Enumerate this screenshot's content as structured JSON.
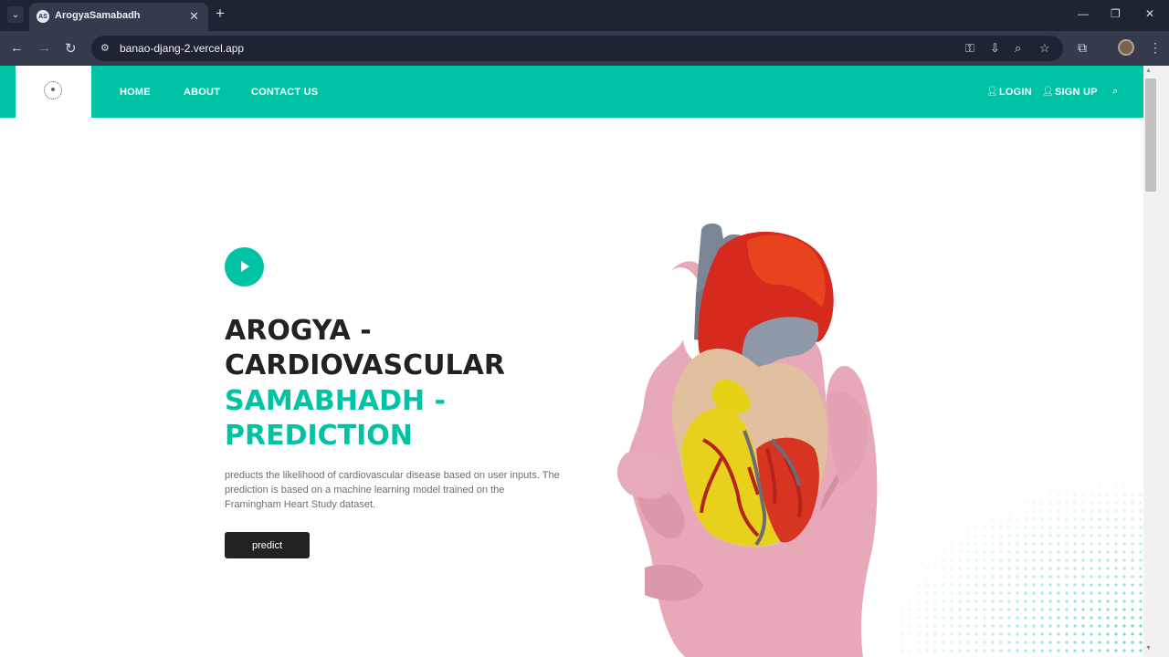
{
  "browser": {
    "tab_title": "ArogyaSamabadh",
    "favicon_text": "AS",
    "url": "banao-djang-2.vercel.app",
    "new_tab_symbol": "+",
    "close_symbol": "✕"
  },
  "navbar": {
    "links": [
      "HOME",
      "ABOUT",
      "CONTACT US"
    ],
    "login": "LOGIN",
    "signup": "SIGN UP"
  },
  "hero": {
    "title_line1": "AROGYA -",
    "title_line2": "CARDIOVASCULAR",
    "title_line3": "SAMABHADH -",
    "title_line4": "PREDICTION",
    "description": "preducts the likelihood of cardiovascular disease based on user inputs. The prediction is based on a machine learning model trained on the Framingham Heart Study dataset.",
    "button_label": "predict"
  },
  "colors": {
    "accent": "#00c3a5",
    "dark": "#222222",
    "browser_bg": "#1f2433"
  }
}
